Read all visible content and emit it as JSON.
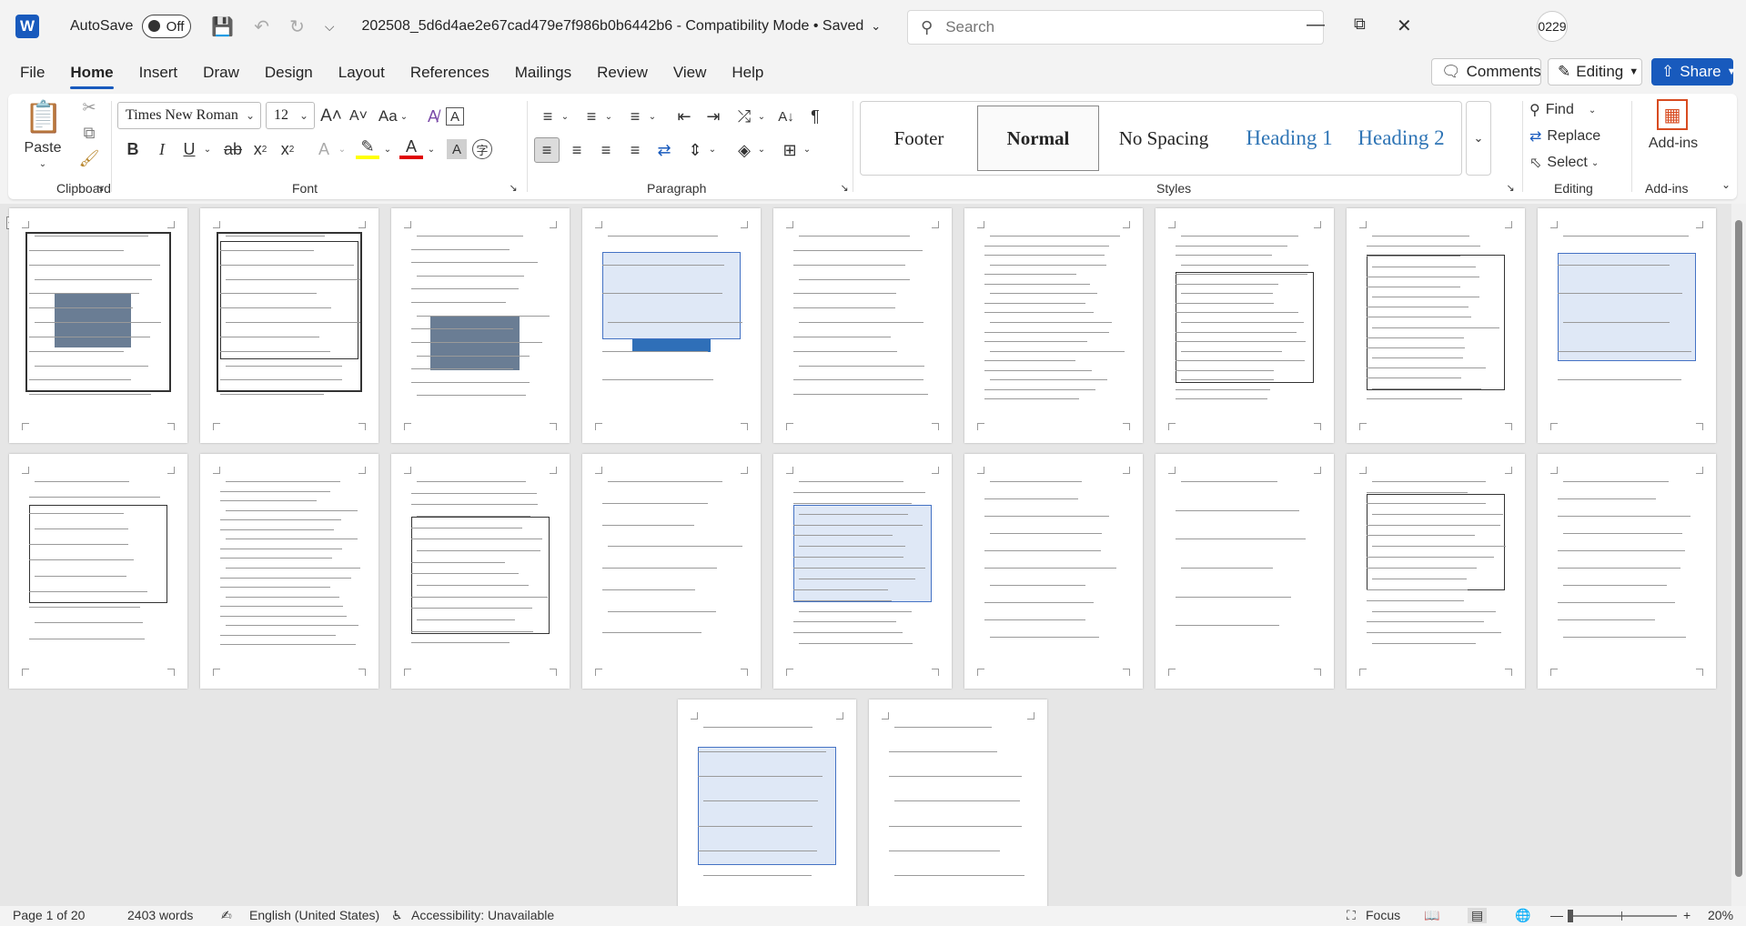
{
  "titlebar": {
    "app_logo": "W",
    "autosave_label": "AutoSave",
    "autosave_state": "Off",
    "doc_title": "202508_5d6d4ae2e67cad479e7f986b0b6442b6  -  Compatibility Mode • Saved",
    "search_placeholder": "Search",
    "user_initials": "0229"
  },
  "tabs": [
    "File",
    "Home",
    "Insert",
    "Draw",
    "Design",
    "Layout",
    "References",
    "Mailings",
    "Review",
    "View",
    "Help"
  ],
  "top_buttons": {
    "comments": "Comments",
    "editing": "Editing",
    "share": "Share"
  },
  "ribbon": {
    "clipboard": {
      "paste": "Paste",
      "label": "Clipboard"
    },
    "font": {
      "family": "Times New Roman",
      "size": "12",
      "change_case": "Aa",
      "label": "Font"
    },
    "paragraph": {
      "label": "Paragraph"
    },
    "styles": {
      "label": "Styles",
      "items": [
        "Footer",
        "Normal",
        "No Spacing",
        "Heading 1",
        "Heading 2"
      ],
      "selected": "Normal"
    },
    "editing": {
      "find": "Find",
      "replace": "Replace",
      "select": "Select",
      "label": "Editing"
    },
    "addins": {
      "button": "Add-ins",
      "label": "Add-ins"
    }
  },
  "statusbar": {
    "page": "Page 1 of 20",
    "words": "2403 words",
    "language": "English (United States)",
    "accessibility": "Accessibility: Unavailable",
    "focus": "Focus",
    "zoom": "20%"
  },
  "colors": {
    "accent": "#185abd",
    "heading": "#2e74b5",
    "table_header": "#4472c4"
  },
  "document": {
    "page_count": 20
  }
}
